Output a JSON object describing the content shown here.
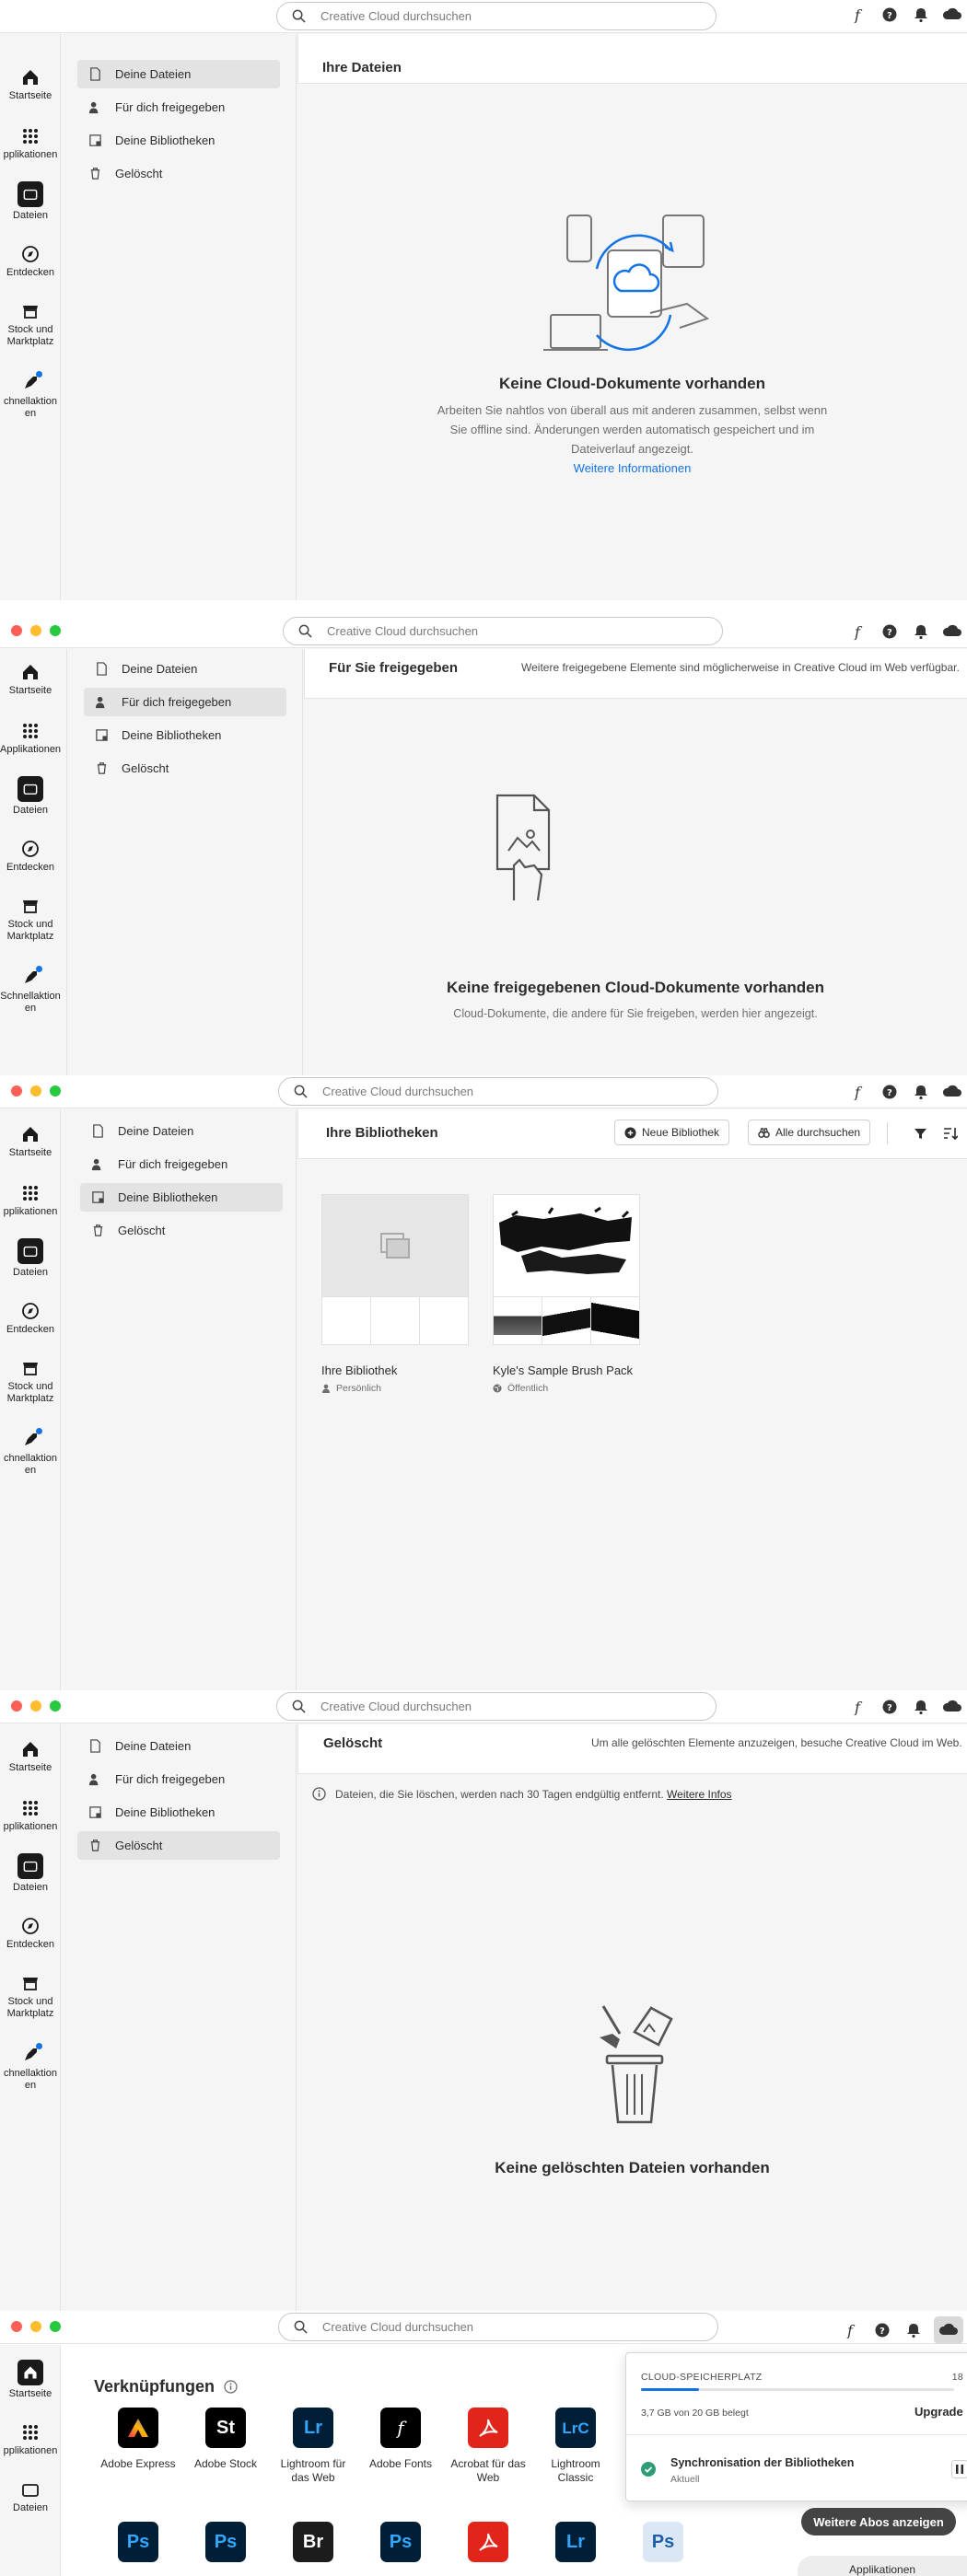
{
  "search": {
    "placeholder": "Creative Cloud durchsuchen"
  },
  "rail": {
    "home": "Startseite",
    "apps": "Applikationen",
    "files": "Dateien",
    "discover": "Entdecken",
    "stock": "Stock und Marktplatz",
    "quick": "Schnellaktionen"
  },
  "rail_lines": {
    "apps_cut": "pplikationen",
    "stock_l1": "Stock und",
    "stock_l2": "Marktplatz",
    "quick_l1_cut": "chnellaktion",
    "quick_l1_full": "Schnellaktion",
    "quick_l2": "en"
  },
  "sub_nav": {
    "your_files": "Deine Dateien",
    "shared": "Für dich freigegeben",
    "libraries": "Deine Bibliotheken",
    "deleted": "Gelöscht"
  },
  "screen1": {
    "title": "Ihre Dateien",
    "empty_title": "Keine Cloud-Dokumente vorhanden",
    "empty_l1": "Arbeiten Sie nahtlos von überall aus mit anderen zusammen, selbst wenn",
    "empty_l2": "Sie offline sind. Änderungen werden automatisch gespeichert und im",
    "empty_l3": "Dateiverlauf angezeigt.",
    "link": "Weitere Informationen"
  },
  "screen2": {
    "title": "Für Sie freigegeben",
    "note": "Weitere freigegebene Elemente sind möglicherweise in Creative Cloud im Web verfügbar.",
    "empty_title": "Keine freigegebenen Cloud-Dokumente vorhanden",
    "empty_body": "Cloud-Dokumente, die andere für Sie freigeben, werden hier angezeigt."
  },
  "screen3": {
    "title": "Ihre Bibliotheken",
    "new_library": "Neue Bibliothek",
    "browse_all": "Alle durchsuchen",
    "libraries": [
      {
        "name": "Ihre Bibliothek",
        "meta": "Persönlich"
      },
      {
        "name": "Kyle's Sample Brush Pack",
        "meta": "Öffentlich"
      }
    ]
  },
  "screen4": {
    "title": "Gelöscht",
    "note": "Um alle gelöschten Elemente anzuzeigen, besuche Creative Cloud im Web.",
    "info": "Dateien, die Sie löschen, werden nach 30 Tagen endgültig entfernt.",
    "info_link": "Weitere Infos",
    "empty_title": "Keine gelöschten Dateien vorhanden"
  },
  "screen5": {
    "shortcuts_title": "Verknüpfungen",
    "apps_row1": [
      {
        "l1": "Adobe Express",
        "l2": "",
        "abbr": "",
        "color": "#000000"
      },
      {
        "l1": "Adobe Stock",
        "l2": "",
        "abbr": "St",
        "color": "#000000"
      },
      {
        "l1": "Lightroom für",
        "l2": "das Web",
        "abbr": "Lr",
        "color": "#001e36"
      },
      {
        "l1": "Adobe Fonts",
        "l2": "",
        "abbr": "f",
        "color": "#000000"
      },
      {
        "l1": "Acrobat für das",
        "l2": "Web",
        "abbr": "",
        "color": "#e1251b"
      },
      {
        "l1": "Lightroom",
        "l2": "Classic",
        "abbr": "LrC",
        "color": "#001e36"
      }
    ],
    "apps_row2": [
      "Ps",
      "Ps",
      "Br",
      "Ps",
      "",
      "Lr",
      "Ps"
    ],
    "storage_label": "CLOUD-SPEICHERPLATZ",
    "storage_cut": "18",
    "storage_used": "3,7 GB von 20 GB belegt",
    "upgrade": "Upgrade",
    "sync_title": "Synchronisation der Bibliotheken",
    "sync_status": "Aktuell",
    "more_subs": "Weitere Abos anzeigen",
    "apps_cut": "Applikationen"
  },
  "colors": {
    "accent": "#1473e6",
    "nav_active": "#e3e3e3",
    "storage_bar": "#1473e6",
    "success": "#2d9d78"
  }
}
